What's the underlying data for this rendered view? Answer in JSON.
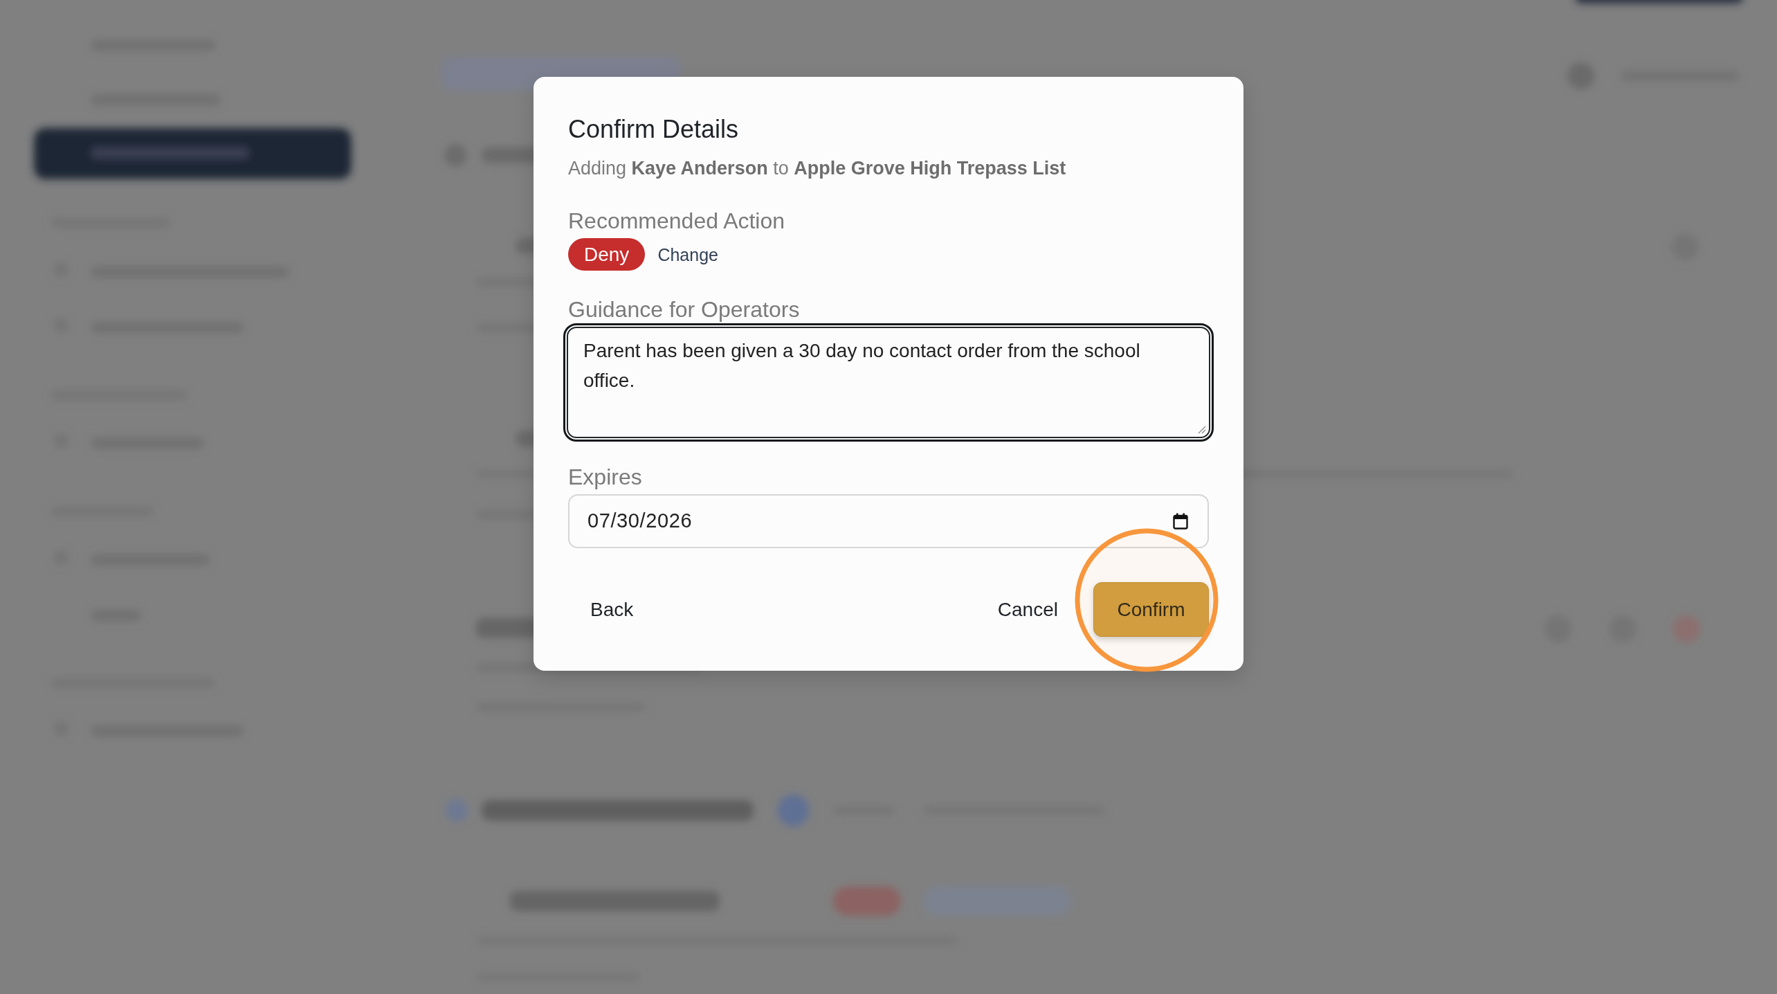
{
  "dialog": {
    "title": "Confirm Details",
    "subtitle": "Adding **Kaye Anderson** to **Apple Grove High Trepass List**",
    "recommended_action": {
      "label": "Recommended Action",
      "action": {
        "label": "Deny",
        "kind": "deny"
      },
      "change_link": "Change"
    },
    "guidance": {
      "label": "Guidance for Operators",
      "value": "Parent has been given a 30 day no contact order from the school office.",
      "focused": true
    },
    "expires": {
      "label": "Expires",
      "value": "07/30/2026"
    },
    "buttons": [
      {
        "label": "Back",
        "kind": "ghost",
        "highlighted": false
      },
      {
        "label": "Cancel",
        "kind": "ghost",
        "highlighted": false
      },
      {
        "label": "Confirm",
        "kind": "primary",
        "highlighted": true
      }
    ]
  }
}
